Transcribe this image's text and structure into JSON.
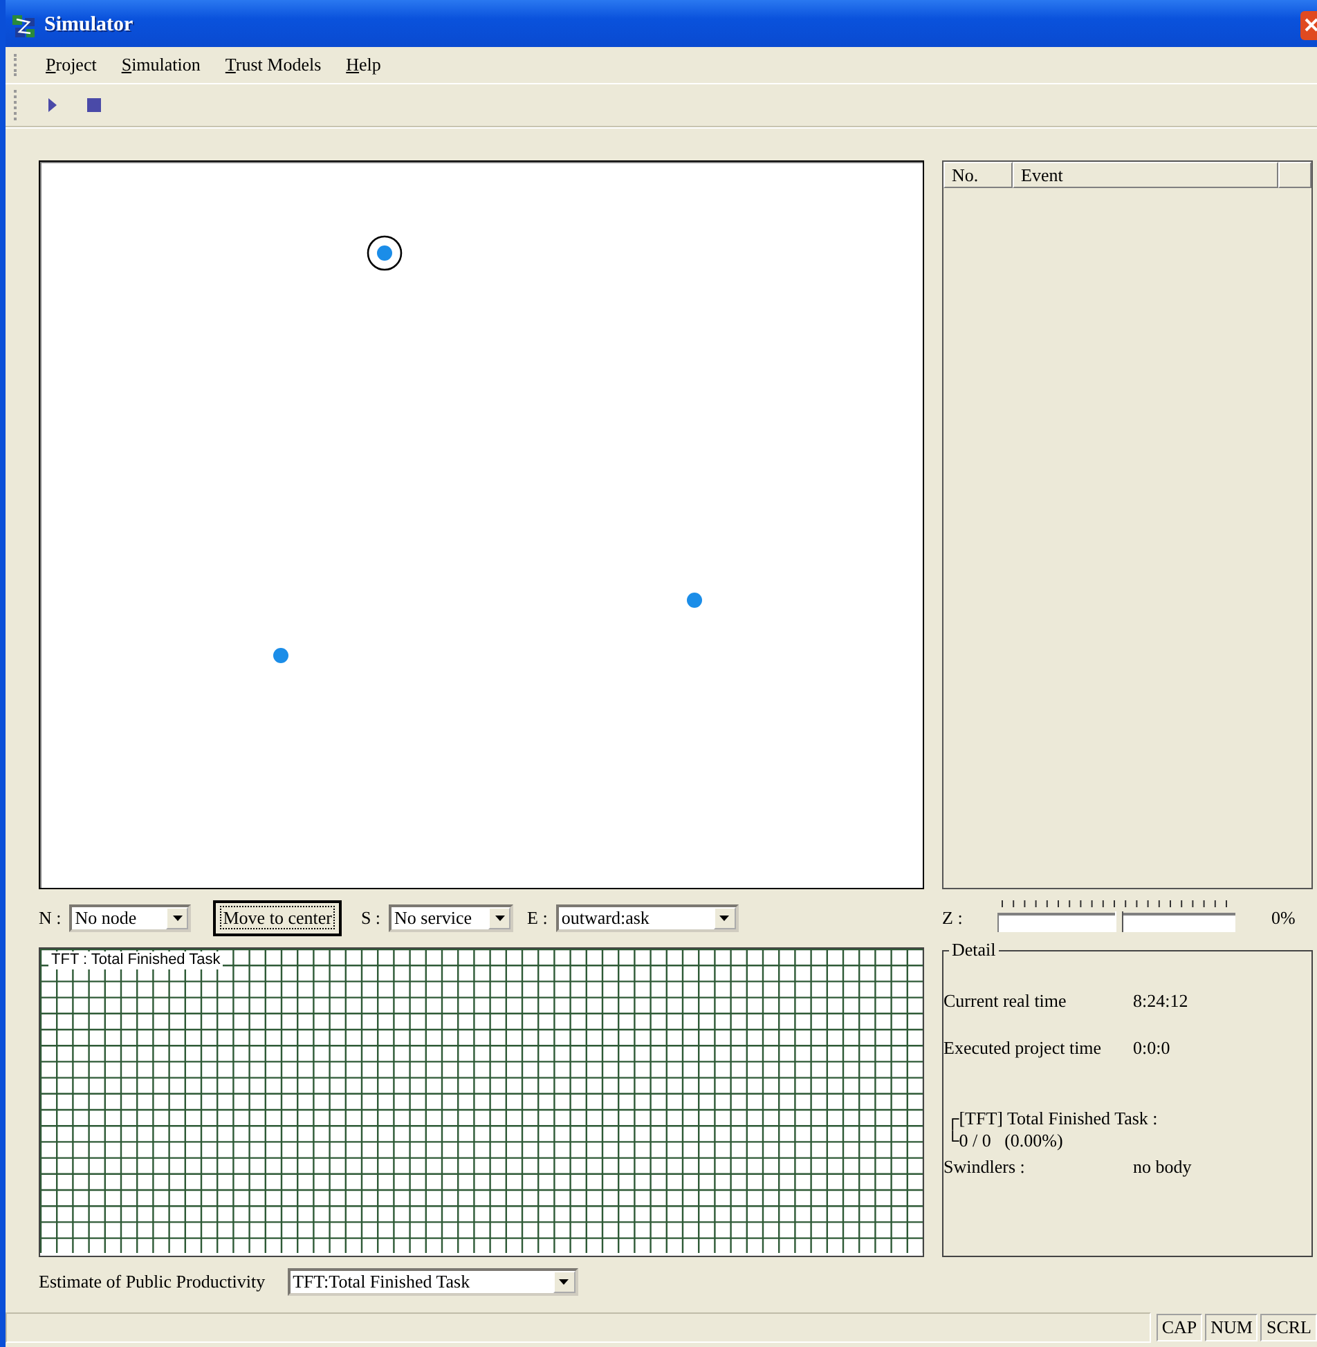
{
  "window": {
    "title": "Simulator"
  },
  "menu": [
    {
      "label": "Project"
    },
    {
      "label": "Simulation"
    },
    {
      "label": "Trust Models"
    },
    {
      "label": "Help"
    }
  ],
  "toolbar": [
    {
      "kind": "play"
    },
    {
      "kind": "stop"
    }
  ],
  "canvas": {
    "nodes": [
      {
        "selected": true
      },
      {
        "selected": false
      },
      {
        "selected": false
      }
    ]
  },
  "event_list": {
    "columns": [
      "No.",
      "Event"
    ]
  },
  "controls": {
    "node": {
      "label": "N :",
      "value": "No node"
    },
    "center_button": "Move to center",
    "service": {
      "label": "S :",
      "value": "No service"
    },
    "event": {
      "label": "E :",
      "value": "outward:ask"
    }
  },
  "zoom": {
    "label": "Z :",
    "level": 0.5,
    "reading": "0%"
  },
  "chart": {
    "title": "TFT : Total Finished Task"
  },
  "detail": {
    "title": "Detail",
    "rows": [
      {
        "label": "Current real time",
        "value": "8:24:12"
      },
      {
        "label": "Executed project time",
        "value": "0:0:0"
      }
    ],
    "tft_heading": "┌[TFT] Total Finished Task :",
    "tft_value": "└0 / 0   (0.00%)",
    "swindlers": {
      "label": "Swindlers :",
      "value": "no body"
    }
  },
  "estimate": {
    "label": "Estimate of Public Productivity",
    "value": "TFT:Total Finished Task"
  },
  "status_bar": {
    "indicators": [
      "CAP",
      "NUM",
      "SCRL"
    ]
  }
}
